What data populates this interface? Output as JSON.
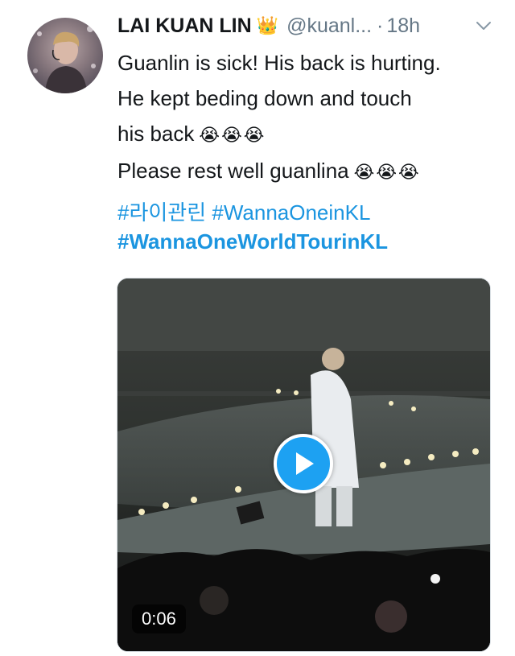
{
  "tweet": {
    "display_name": "LAI KUAN LIN",
    "crown_emoji": "👑",
    "handle": "@kuanl...",
    "separator": "·",
    "time": "18h",
    "lines": [
      "Guanlin is sick! His back is hurting.",
      "He kept beding down and touch",
      "his back"
    ],
    "line4": "Please rest well guanlina",
    "emoji_sobbing": "😭😭😭",
    "hashtags": [
      "#라이관린",
      "#WannaOneinKL",
      "#WannaOneWorldTourinKL"
    ]
  },
  "media": {
    "duration": "0:06",
    "play_icon": "play-icon"
  },
  "icons": {
    "menu": "chevron-down-icon",
    "avatar": "avatar"
  },
  "colors": {
    "link": "#1b95e0",
    "play": "#1da1f2",
    "muted": "#657786"
  }
}
